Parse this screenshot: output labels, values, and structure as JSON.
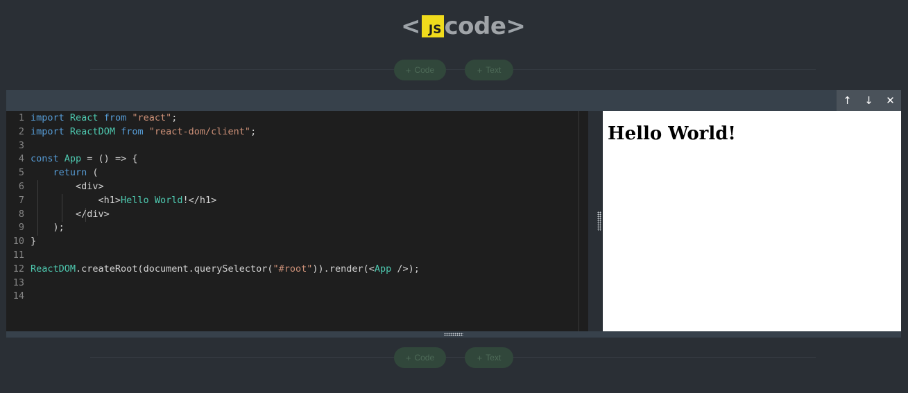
{
  "logo": {
    "left_bracket": "<",
    "js": "JS",
    "word": "code",
    "right_bracket": ">"
  },
  "add_bar": {
    "code_label": "Code",
    "text_label": "Text",
    "plus": "+"
  },
  "cell_actions": {
    "up": "↑",
    "down": "↓",
    "close": "✕"
  },
  "editor": {
    "lines": [
      {
        "n": "1",
        "tokens": [
          [
            "kw",
            "import"
          ],
          [
            "pl",
            " "
          ],
          [
            "id",
            "React"
          ],
          [
            "pl",
            " "
          ],
          [
            "kw",
            "from"
          ],
          [
            "pl",
            " "
          ],
          [
            "str",
            "\"react\""
          ],
          [
            "pl",
            ";"
          ]
        ]
      },
      {
        "n": "2",
        "tokens": [
          [
            "kw",
            "import"
          ],
          [
            "pl",
            " "
          ],
          [
            "id",
            "ReactDOM"
          ],
          [
            "pl",
            " "
          ],
          [
            "kw",
            "from"
          ],
          [
            "pl",
            " "
          ],
          [
            "str",
            "\"react-dom/client\""
          ],
          [
            "pl",
            ";"
          ]
        ]
      },
      {
        "n": "3",
        "tokens": []
      },
      {
        "n": "4",
        "tokens": [
          [
            "kw",
            "const"
          ],
          [
            "pl",
            " "
          ],
          [
            "id",
            "App"
          ],
          [
            "pl",
            " = () => {"
          ]
        ]
      },
      {
        "n": "5",
        "tokens": [
          [
            "pl",
            "    "
          ],
          [
            "kw",
            "return"
          ],
          [
            "pl",
            " ("
          ]
        ]
      },
      {
        "n": "6",
        "tokens": [
          [
            "pl",
            "        <div>"
          ]
        ]
      },
      {
        "n": "7",
        "tokens": [
          [
            "pl",
            "            <h1>"
          ],
          [
            "id",
            "Hello"
          ],
          [
            "pl",
            " "
          ],
          [
            "id",
            "World"
          ],
          [
            "pl",
            "!</h1>"
          ]
        ]
      },
      {
        "n": "8",
        "tokens": [
          [
            "pl",
            "        </div>"
          ]
        ]
      },
      {
        "n": "9",
        "tokens": [
          [
            "pl",
            "    );"
          ]
        ]
      },
      {
        "n": "10",
        "tokens": [
          [
            "pl",
            "}"
          ]
        ]
      },
      {
        "n": "11",
        "tokens": []
      },
      {
        "n": "12",
        "tokens": [
          [
            "id",
            "ReactDOM"
          ],
          [
            "pl",
            ".createRoot(document.querySelector("
          ],
          [
            "str",
            "\"#root\""
          ],
          [
            "pl",
            "))."
          ],
          [
            "pl",
            "render(<"
          ],
          [
            "id",
            "App"
          ],
          [
            "pl",
            " />);"
          ]
        ]
      },
      {
        "n": "13",
        "tokens": []
      },
      {
        "n": "14",
        "tokens": []
      }
    ]
  },
  "preview": {
    "heading": "Hello World!"
  },
  "colors": {
    "keyword": "#569cd6",
    "identifier": "#4ec9b0",
    "string": "#ce9178",
    "logo_yellow": "#f0db1c",
    "background": "#2a2f35"
  }
}
